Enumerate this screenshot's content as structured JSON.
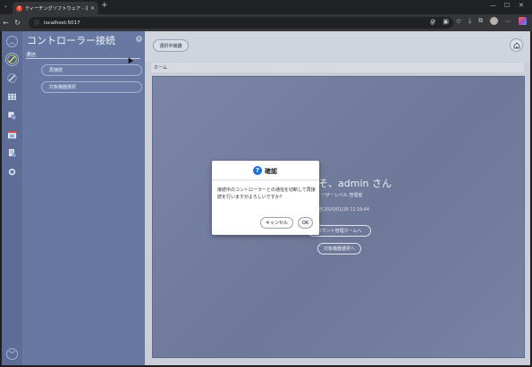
{
  "browser": {
    "tab_title": "ティーチングソフトウェア - ホーム",
    "url": "localhost:5017",
    "favicon_text": "T"
  },
  "sidebar": {
    "title": "コントローラー接続",
    "section": "通信",
    "buttons": [
      "再接続",
      "対象機器選択"
    ],
    "icons": [
      "pen-icon",
      "pencil-icon",
      "grid-icon",
      "hand-pointer-icon",
      "calendar-icon",
      "document-icon",
      "settings-icon"
    ]
  },
  "header": {
    "selected_device_button": "選択中機器",
    "breadcrumb": "ホーム"
  },
  "welcome": {
    "title": "そ、admin さん",
    "user_level": "ーザーレベル 管理者",
    "last_login": "回 2020/01/26 11:19:44",
    "account_button": "カウント管理ホームへ",
    "device_button": "対象機器選択へ"
  },
  "dialog": {
    "title": "確認",
    "message": "接続中のコントローラーとの通信を切断して再接続を行いますがよろしいですか?",
    "cancel": "キャンセル",
    "ok": "OK"
  },
  "colors": {
    "sidebar": "#6779a3",
    "rail": "#5d6d95",
    "content": "#7680a1",
    "dialog_icon": "#1e6fd9"
  }
}
